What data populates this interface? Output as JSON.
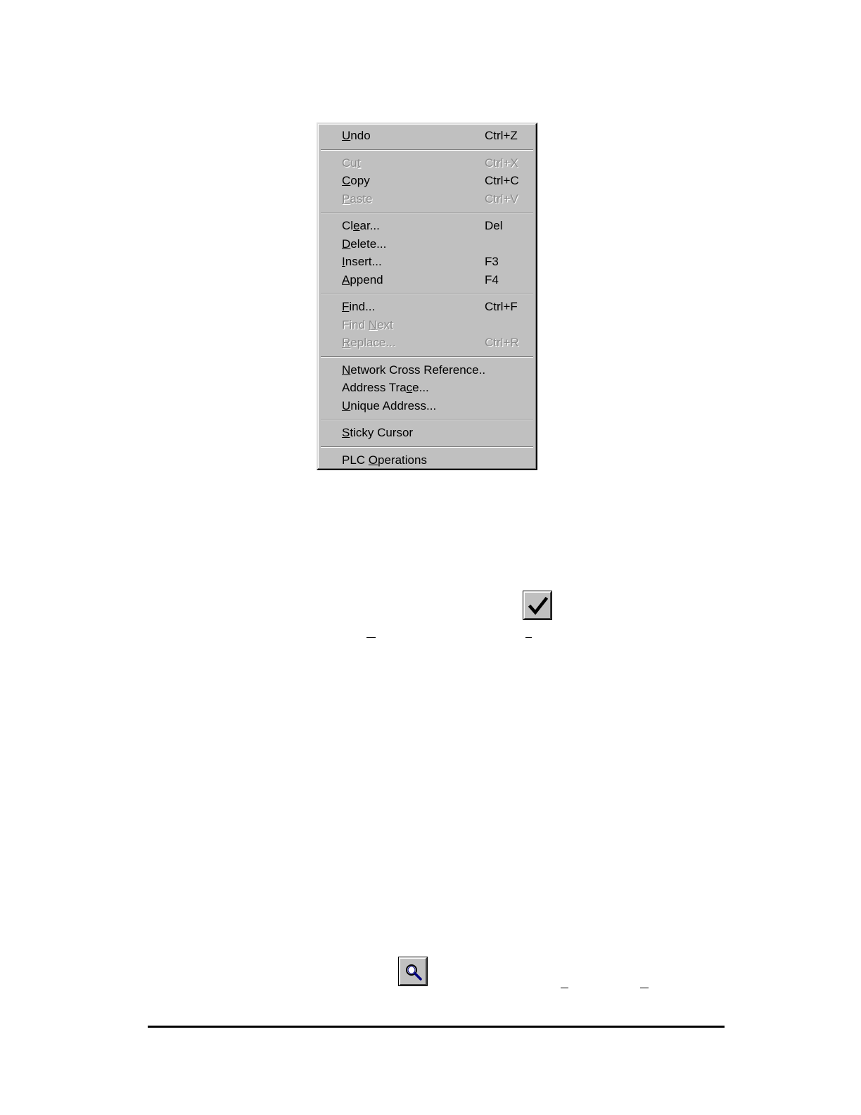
{
  "menu": {
    "groups": [
      [
        {
          "pre": "",
          "key": "U",
          "post": "ndo",
          "shortcut": "Ctrl+Z",
          "enabled": true
        }
      ],
      [
        {
          "pre": "Cu",
          "key": "t",
          "post": "",
          "shortcut": "Ctrl+X",
          "enabled": false
        },
        {
          "pre": "",
          "key": "C",
          "post": "opy",
          "shortcut": "Ctrl+C",
          "enabled": true
        },
        {
          "pre": "",
          "key": "P",
          "post": "aste",
          "shortcut": "Ctrl+V",
          "enabled": false
        }
      ],
      [
        {
          "pre": "Cl",
          "key": "e",
          "post": "ar...",
          "shortcut": "Del",
          "enabled": true
        },
        {
          "pre": "",
          "key": "D",
          "post": "elete...",
          "shortcut": "",
          "enabled": true
        },
        {
          "pre": "",
          "key": "I",
          "post": "nsert...",
          "shortcut": "F3",
          "enabled": true
        },
        {
          "pre": "",
          "key": "A",
          "post": "ppend",
          "shortcut": "F4",
          "enabled": true
        }
      ],
      [
        {
          "pre": "",
          "key": "F",
          "post": "ind...",
          "shortcut": "Ctrl+F",
          "enabled": true
        },
        {
          "pre": "Find ",
          "key": "N",
          "post": "ext",
          "shortcut": "",
          "enabled": false
        },
        {
          "pre": "",
          "key": "R",
          "post": "eplace...",
          "shortcut": "Ctrl+R",
          "enabled": false
        }
      ],
      [
        {
          "pre": "",
          "key": "N",
          "post": "etwork Cross Reference..",
          "shortcut": "",
          "enabled": true
        },
        {
          "pre": "Address Tra",
          "key": "c",
          "post": "e...",
          "shortcut": "",
          "enabled": true
        },
        {
          "pre": "",
          "key": "U",
          "post": "nique Address...",
          "shortcut": "",
          "enabled": true
        }
      ],
      [
        {
          "pre": "",
          "key": "S",
          "post": "ticky Cursor",
          "shortcut": "",
          "enabled": true
        }
      ],
      [
        {
          "pre": "PLC ",
          "key": "O",
          "post": "perations",
          "shortcut": "",
          "enabled": true
        }
      ]
    ]
  },
  "icons": {
    "check_button": "checkmark-icon",
    "find_button": "magnifier-icon"
  },
  "colors": {
    "menu_background": "#c0c0c0",
    "disabled_text": "#8a8a8a",
    "magnifier_lens": "#000080"
  }
}
